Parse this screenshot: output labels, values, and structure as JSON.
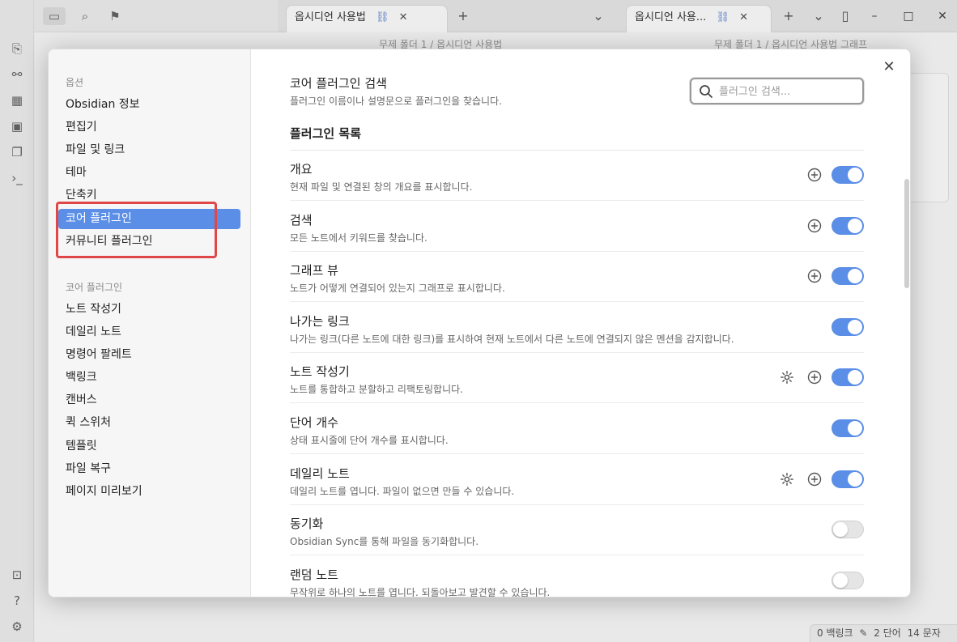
{
  "background": {
    "tab1_title": "옵시디언 사용법",
    "tab2_title": "옵시디언 사용...",
    "breadcrumb1": "무제 폴더 1 / 옵시디언 사용법",
    "breadcrumb2": "무제 폴더 1 / 옵시디언 사용법 그래프",
    "status": {
      "backlinks": "0 백링크",
      "words": "2 단어",
      "chars": "14 문자"
    }
  },
  "sidebar": {
    "section_options": "옵션",
    "options": [
      {
        "label": "Obsidian 정보"
      },
      {
        "label": "편집기"
      },
      {
        "label": "파일 및 링크"
      },
      {
        "label": "테마"
      },
      {
        "label": "단축키"
      },
      {
        "label": "코어 플러그인",
        "active": true
      },
      {
        "label": "커뮤니티 플러그인"
      }
    ],
    "section_core": "코어 플러그인",
    "core_items": [
      {
        "label": "노트 작성기"
      },
      {
        "label": "데일리 노트"
      },
      {
        "label": "명령어 팔레트"
      },
      {
        "label": "백링크"
      },
      {
        "label": "캔버스"
      },
      {
        "label": "퀵 스위처"
      },
      {
        "label": "템플릿"
      },
      {
        "label": "파일 복구"
      },
      {
        "label": "페이지 미리보기"
      }
    ]
  },
  "search": {
    "title": "코어 플러그인 검색",
    "description": "플러그인 이름이나 설명문으로 플러그인을 찾습니다.",
    "placeholder": "플러그인 검색..."
  },
  "list_heading": "플러그인 목록",
  "plugins": [
    {
      "name": "개요",
      "desc": "현재 파일 및 연결된 창의 개요를 표시합니다.",
      "enabled": true,
      "hotkey": true,
      "settings": false
    },
    {
      "name": "검색",
      "desc": "모든 노트에서 키워드를 찾습니다.",
      "enabled": true,
      "hotkey": true,
      "settings": false
    },
    {
      "name": "그래프 뷰",
      "desc": "노트가 어떻게 연결되어 있는지 그래프로 표시합니다.",
      "enabled": true,
      "hotkey": true,
      "settings": false
    },
    {
      "name": "나가는 링크",
      "desc": "나가는 링크(다른 노트에 대한 링크)를 표시하여 현재 노트에서 다른 노트에 연결되지 않은 멘션을 감지합니다.",
      "enabled": true,
      "hotkey": false,
      "settings": false
    },
    {
      "name": "노트 작성기",
      "desc": "노트를 통합하고 분할하고 리팩토링합니다.",
      "enabled": true,
      "hotkey": true,
      "settings": true
    },
    {
      "name": "단어 개수",
      "desc": "상태 표시줄에 단어 개수를 표시합니다.",
      "enabled": true,
      "hotkey": false,
      "settings": false
    },
    {
      "name": "데일리 노트",
      "desc": "데일리 노트를 엽니다. 파일이 없으면 만들 수 있습니다.",
      "enabled": true,
      "hotkey": true,
      "settings": true
    },
    {
      "name": "동기화",
      "desc": "Obsidian Sync를 통해 파일을 동기화합니다.",
      "enabled": false,
      "hotkey": false,
      "settings": false
    },
    {
      "name": "랜덤 노트",
      "desc": "무작위로 하나의 노트를 엽니다. 되돌아보고 발견할 수 있습니다.",
      "enabled": false,
      "hotkey": false,
      "settings": false
    }
  ],
  "colors": {
    "accent": "#5b8ee6",
    "highlight": "#e04747"
  }
}
